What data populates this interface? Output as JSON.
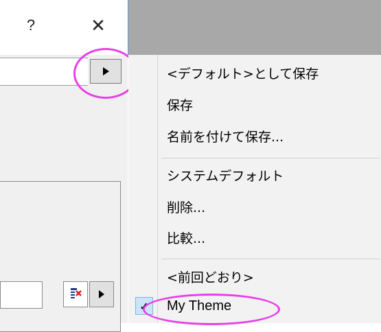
{
  "title_bar": {
    "help_label": "?",
    "close_label": "✕"
  },
  "menu": {
    "items": [
      {
        "label": "<デフォルト>として保存"
      },
      {
        "label": "保存"
      },
      {
        "label": "名前を付けて保存..."
      },
      {
        "label": "システムデフォルト"
      },
      {
        "label": "削除..."
      },
      {
        "label": "比較..."
      },
      {
        "label": "<前回どおり>"
      },
      {
        "label": "My Theme",
        "checked": true
      }
    ],
    "check_mark": "✓"
  },
  "icons": {
    "arrow_button": "play-arrow-icon",
    "small_icon_button": "pencil-edit-icon",
    "small_arrow_button": "play-arrow-icon"
  },
  "colors": {
    "highlight": "#e83ee8",
    "menu_bg": "#f2f2f2",
    "title_band": "#a8a8a8"
  }
}
